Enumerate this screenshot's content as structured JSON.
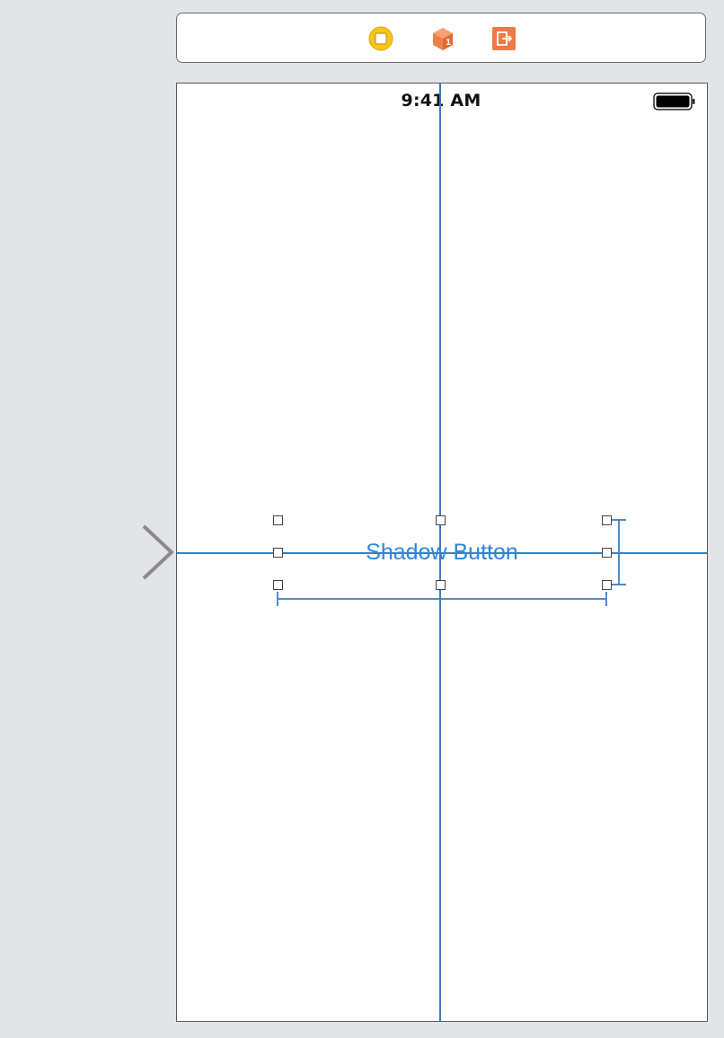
{
  "scene_dock": {
    "icons": [
      "view-controller-icon",
      "first-responder-icon",
      "exit-icon"
    ]
  },
  "status_bar": {
    "time": "9:41 AM"
  },
  "button": {
    "title": "Shadow Button"
  },
  "colors": {
    "guide": "#3a7fbf",
    "button_text": "#2f86d4",
    "view_controller": "#f5c518",
    "first_responder": "#f0804a",
    "exit": "#ee7a47",
    "canvas_background": "#e3e4e8"
  }
}
